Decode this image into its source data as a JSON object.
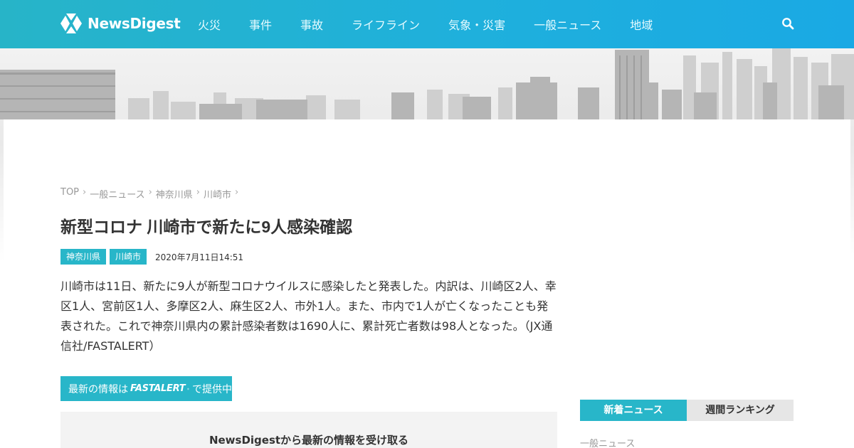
{
  "header": {
    "logo_text": "NewsDigest",
    "nav": [
      "火災",
      "事件",
      "事故",
      "ライフライン",
      "気象・災害",
      "一般ニュース",
      "地域"
    ],
    "search_icon": "search-icon"
  },
  "colors": {
    "header_start": "#27b4c8",
    "header_end": "#1aa9e4",
    "accent": "#28b6c9"
  },
  "breadcrumb": [
    "TOP",
    "一般ニュース",
    "神奈川県",
    "川崎市"
  ],
  "article": {
    "title": "新型コロナ 川崎市で新たに9人感染確認",
    "tags": [
      "神奈川県",
      "川崎市"
    ],
    "date": "2020年7月11日14:51",
    "body": "川崎市は11日、新たに9人が新型コロナウイルスに感染したと発表した。内訳は、川崎区2人、幸区1人、宮前区1人、多摩区2人、麻生区2人、市外1人。また、市内で1人が亡くなったことも発表された。これで神奈川県内の累計感染者数は1690人に、累計死亡者数は98人となった。（JX通信社/FASTALERT）"
  },
  "provider": {
    "prefix": "最新の情報は",
    "brand": "FASTALERT",
    "suffix": "で提供中"
  },
  "subscribe": {
    "text": "NewsDigestから最新の情報を受け取る"
  },
  "sidebar": {
    "tabs": [
      "新着ニュース",
      "週間ランキング"
    ],
    "category": "一般ニュース"
  }
}
